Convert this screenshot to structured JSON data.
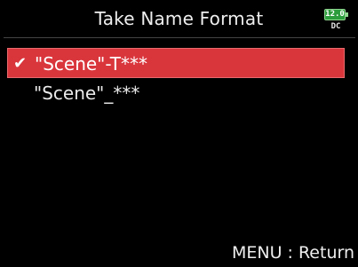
{
  "header": {
    "title": "Take Name Format",
    "battery": {
      "voltage": "12.0",
      "source": "DC",
      "color": "#2c9c3c"
    }
  },
  "options": [
    {
      "label": "\"Scene\"-T***",
      "selected": true,
      "check_icon": "check-icon"
    },
    {
      "label": "\"Scene\"_***",
      "selected": false
    }
  ],
  "footer": {
    "hint": "MENU : Return"
  },
  "colors": {
    "background": "#000000",
    "selection": "#d9363c",
    "text": "#f2f2f2"
  }
}
